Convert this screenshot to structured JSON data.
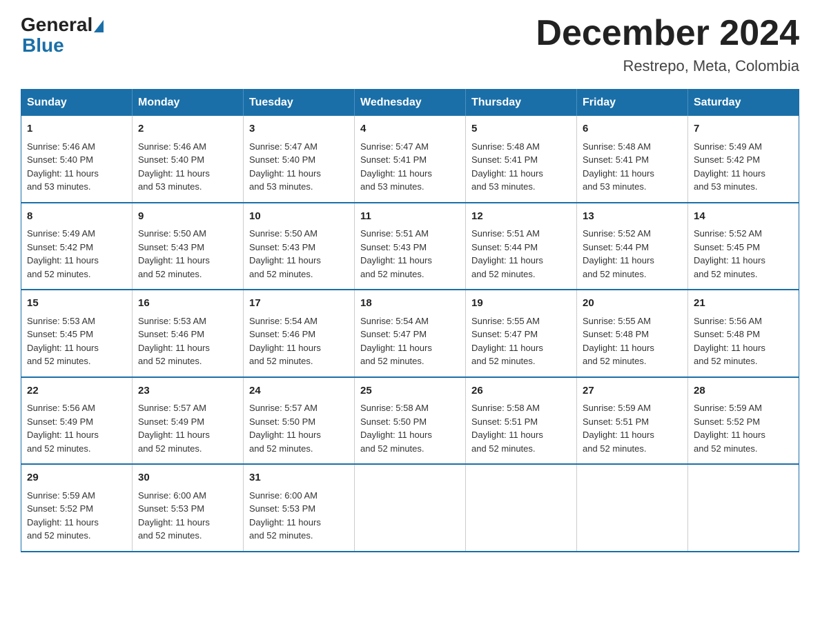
{
  "header": {
    "logo": {
      "text_general": "General",
      "text_blue": "Blue"
    },
    "title": "December 2024",
    "location": "Restrepo, Meta, Colombia"
  },
  "days_of_week": [
    "Sunday",
    "Monday",
    "Tuesday",
    "Wednesday",
    "Thursday",
    "Friday",
    "Saturday"
  ],
  "weeks": [
    [
      {
        "day": "1",
        "sunrise": "5:46 AM",
        "sunset": "5:40 PM",
        "daylight": "11 hours and 53 minutes."
      },
      {
        "day": "2",
        "sunrise": "5:46 AM",
        "sunset": "5:40 PM",
        "daylight": "11 hours and 53 minutes."
      },
      {
        "day": "3",
        "sunrise": "5:47 AM",
        "sunset": "5:40 PM",
        "daylight": "11 hours and 53 minutes."
      },
      {
        "day": "4",
        "sunrise": "5:47 AM",
        "sunset": "5:41 PM",
        "daylight": "11 hours and 53 minutes."
      },
      {
        "day": "5",
        "sunrise": "5:48 AM",
        "sunset": "5:41 PM",
        "daylight": "11 hours and 53 minutes."
      },
      {
        "day": "6",
        "sunrise": "5:48 AM",
        "sunset": "5:41 PM",
        "daylight": "11 hours and 53 minutes."
      },
      {
        "day": "7",
        "sunrise": "5:49 AM",
        "sunset": "5:42 PM",
        "daylight": "11 hours and 53 minutes."
      }
    ],
    [
      {
        "day": "8",
        "sunrise": "5:49 AM",
        "sunset": "5:42 PM",
        "daylight": "11 hours and 52 minutes."
      },
      {
        "day": "9",
        "sunrise": "5:50 AM",
        "sunset": "5:43 PM",
        "daylight": "11 hours and 52 minutes."
      },
      {
        "day": "10",
        "sunrise": "5:50 AM",
        "sunset": "5:43 PM",
        "daylight": "11 hours and 52 minutes."
      },
      {
        "day": "11",
        "sunrise": "5:51 AM",
        "sunset": "5:43 PM",
        "daylight": "11 hours and 52 minutes."
      },
      {
        "day": "12",
        "sunrise": "5:51 AM",
        "sunset": "5:44 PM",
        "daylight": "11 hours and 52 minutes."
      },
      {
        "day": "13",
        "sunrise": "5:52 AM",
        "sunset": "5:44 PM",
        "daylight": "11 hours and 52 minutes."
      },
      {
        "day": "14",
        "sunrise": "5:52 AM",
        "sunset": "5:45 PM",
        "daylight": "11 hours and 52 minutes."
      }
    ],
    [
      {
        "day": "15",
        "sunrise": "5:53 AM",
        "sunset": "5:45 PM",
        "daylight": "11 hours and 52 minutes."
      },
      {
        "day": "16",
        "sunrise": "5:53 AM",
        "sunset": "5:46 PM",
        "daylight": "11 hours and 52 minutes."
      },
      {
        "day": "17",
        "sunrise": "5:54 AM",
        "sunset": "5:46 PM",
        "daylight": "11 hours and 52 minutes."
      },
      {
        "day": "18",
        "sunrise": "5:54 AM",
        "sunset": "5:47 PM",
        "daylight": "11 hours and 52 minutes."
      },
      {
        "day": "19",
        "sunrise": "5:55 AM",
        "sunset": "5:47 PM",
        "daylight": "11 hours and 52 minutes."
      },
      {
        "day": "20",
        "sunrise": "5:55 AM",
        "sunset": "5:48 PM",
        "daylight": "11 hours and 52 minutes."
      },
      {
        "day": "21",
        "sunrise": "5:56 AM",
        "sunset": "5:48 PM",
        "daylight": "11 hours and 52 minutes."
      }
    ],
    [
      {
        "day": "22",
        "sunrise": "5:56 AM",
        "sunset": "5:49 PM",
        "daylight": "11 hours and 52 minutes."
      },
      {
        "day": "23",
        "sunrise": "5:57 AM",
        "sunset": "5:49 PM",
        "daylight": "11 hours and 52 minutes."
      },
      {
        "day": "24",
        "sunrise": "5:57 AM",
        "sunset": "5:50 PM",
        "daylight": "11 hours and 52 minutes."
      },
      {
        "day": "25",
        "sunrise": "5:58 AM",
        "sunset": "5:50 PM",
        "daylight": "11 hours and 52 minutes."
      },
      {
        "day": "26",
        "sunrise": "5:58 AM",
        "sunset": "5:51 PM",
        "daylight": "11 hours and 52 minutes."
      },
      {
        "day": "27",
        "sunrise": "5:59 AM",
        "sunset": "5:51 PM",
        "daylight": "11 hours and 52 minutes."
      },
      {
        "day": "28",
        "sunrise": "5:59 AM",
        "sunset": "5:52 PM",
        "daylight": "11 hours and 52 minutes."
      }
    ],
    [
      {
        "day": "29",
        "sunrise": "5:59 AM",
        "sunset": "5:52 PM",
        "daylight": "11 hours and 52 minutes."
      },
      {
        "day": "30",
        "sunrise": "6:00 AM",
        "sunset": "5:53 PM",
        "daylight": "11 hours and 52 minutes."
      },
      {
        "day": "31",
        "sunrise": "6:00 AM",
        "sunset": "5:53 PM",
        "daylight": "11 hours and 52 minutes."
      },
      null,
      null,
      null,
      null
    ]
  ],
  "labels": {
    "sunrise": "Sunrise:",
    "sunset": "Sunset:",
    "daylight": "Daylight:"
  }
}
